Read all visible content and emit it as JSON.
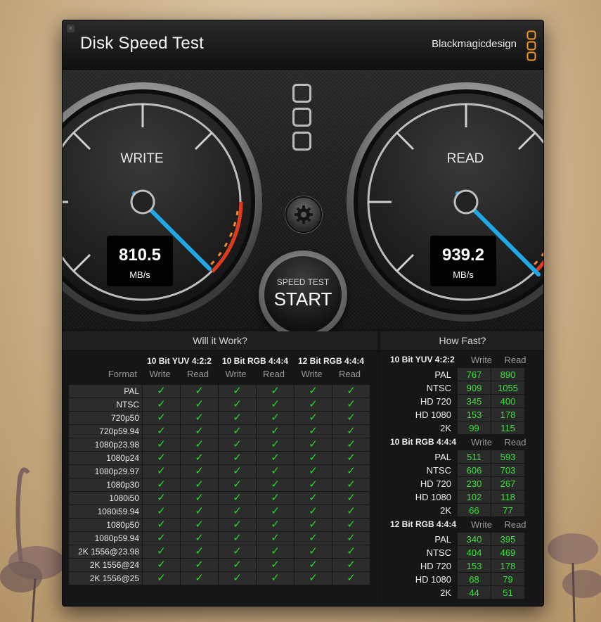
{
  "window": {
    "title": "Disk Speed Test",
    "close_glyph": "×",
    "brand": "Blackmagicdesign"
  },
  "gauges": {
    "write": {
      "label": "WRITE",
      "value": "810.5",
      "unit": "MB/s"
    },
    "read": {
      "label": "READ",
      "value": "939.2",
      "unit": "MB/s"
    }
  },
  "controls": {
    "start_small": "SPEED TEST",
    "start_big": "START",
    "settings_icon": "gear-icon"
  },
  "will_it_work": {
    "header": "Will it Work?",
    "format_header": "Format",
    "groups": [
      "10 Bit YUV 4:2:2",
      "10 Bit RGB 4:4:4",
      "12 Bit RGB 4:4:4"
    ],
    "sub_headers": [
      "Write",
      "Read",
      "Write",
      "Read",
      "Write",
      "Read"
    ],
    "check_glyph": "✓",
    "formats": [
      "PAL",
      "NTSC",
      "720p50",
      "720p59.94",
      "1080p23.98",
      "1080p24",
      "1080p29.97",
      "1080p30",
      "1080i50",
      "1080i59.94",
      "1080p50",
      "1080p59.94",
      "2K 1556@23.98",
      "2K 1556@24",
      "2K 1556@25"
    ]
  },
  "how_fast": {
    "header": "How Fast?",
    "write_label": "Write",
    "read_label": "Read",
    "groups": [
      {
        "title": "10 Bit YUV 4:2:2",
        "rows": [
          {
            "format": "PAL",
            "write": "767",
            "read": "890"
          },
          {
            "format": "NTSC",
            "write": "909",
            "read": "1055"
          },
          {
            "format": "HD 720",
            "write": "345",
            "read": "400"
          },
          {
            "format": "HD 1080",
            "write": "153",
            "read": "178"
          },
          {
            "format": "2K",
            "write": "99",
            "read": "115"
          }
        ]
      },
      {
        "title": "10 Bit RGB 4:4:4",
        "rows": [
          {
            "format": "PAL",
            "write": "511",
            "read": "593"
          },
          {
            "format": "NTSC",
            "write": "606",
            "read": "703"
          },
          {
            "format": "HD 720",
            "write": "230",
            "read": "267"
          },
          {
            "format": "HD 1080",
            "write": "102",
            "read": "118"
          },
          {
            "format": "2K",
            "write": "66",
            "read": "77"
          }
        ]
      },
      {
        "title": "12 Bit RGB 4:4:4",
        "rows": [
          {
            "format": "PAL",
            "write": "340",
            "read": "395"
          },
          {
            "format": "NTSC",
            "write": "404",
            "read": "469"
          },
          {
            "format": "HD 720",
            "write": "153",
            "read": "178"
          },
          {
            "format": "HD 1080",
            "write": "68",
            "read": "79"
          },
          {
            "format": "2K",
            "write": "44",
            "read": "51"
          }
        ]
      }
    ]
  },
  "colors": {
    "accent_needle": "#1fa7e6",
    "check_green": "#2ed630",
    "number_green": "#39e339",
    "red_zone": "#e03a1e",
    "orange_zone": "#f08a2a"
  }
}
